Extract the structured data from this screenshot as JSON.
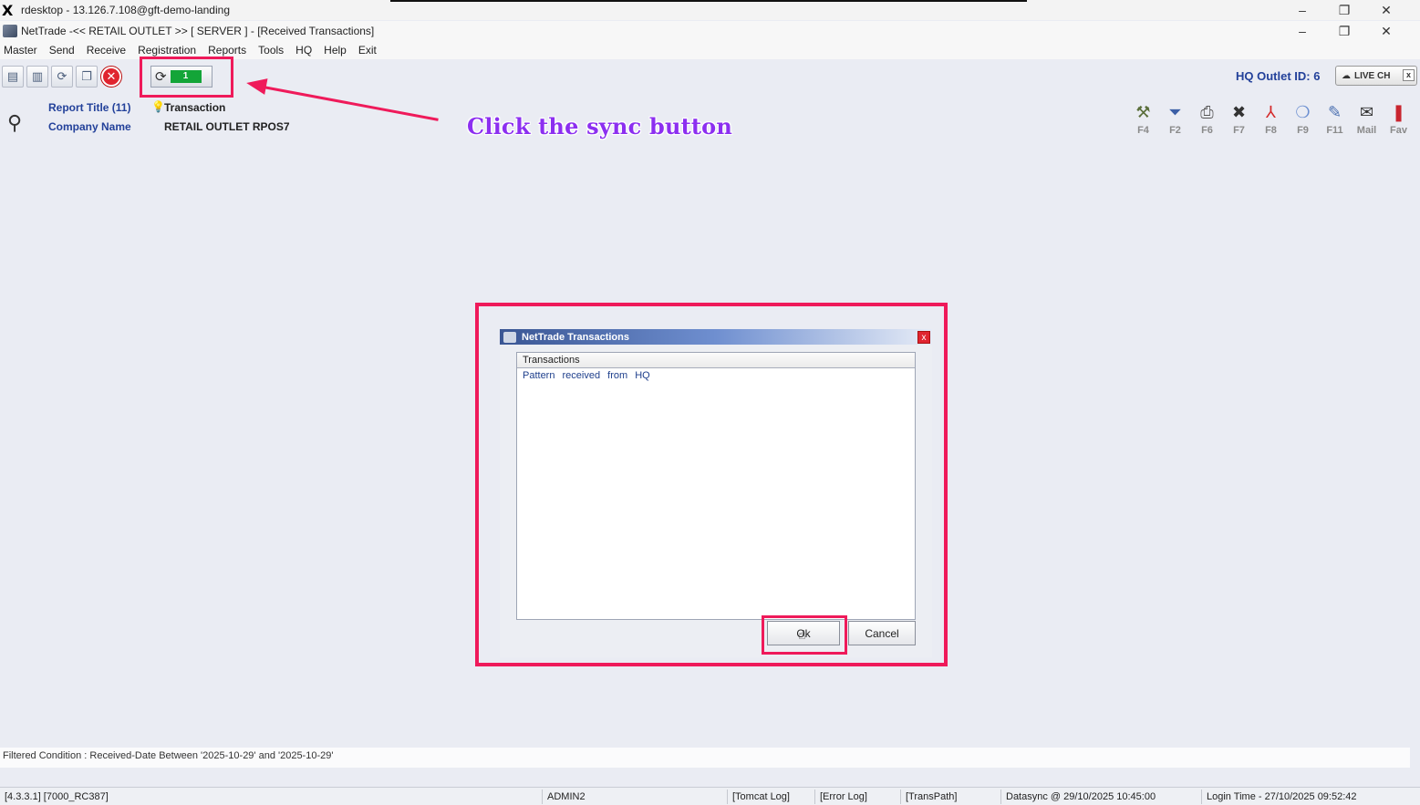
{
  "outer_window": {
    "title": "rdesktop - 13.126.7.108@gft-demo-landing",
    "x_logo": "X",
    "controls": [
      "–",
      "❐",
      "✕"
    ]
  },
  "app_window": {
    "title": "NetTrade -<< RETAIL OUTLET >> [ SERVER ] - [Received Transactions]",
    "controls": [
      "–",
      "❐",
      "✕"
    ]
  },
  "menu": [
    "Master",
    "Send",
    "Receive",
    "Registration",
    "Reports",
    "Tools",
    "HQ",
    "Help",
    "Exit"
  ],
  "toolbar": {
    "buttons": [
      {
        "icon": "new-document-icon",
        "glyph": "▤"
      },
      {
        "icon": "delete-document-icon",
        "glyph": "▥"
      },
      {
        "icon": "refresh-document-icon",
        "glyph": "⟳"
      },
      {
        "icon": "clipboard-icon",
        "glyph": "❐"
      },
      {
        "icon": "close-circle-icon",
        "glyph": "✕"
      }
    ],
    "sync": {
      "icon": "sync-icon",
      "glyph": "⟳",
      "count": "1"
    }
  },
  "annotation": {
    "text": "Click the sync button"
  },
  "hq": {
    "label": "HQ Outlet ID: 6",
    "live_button": "LIVE CH",
    "live_close": "x"
  },
  "report": {
    "title_label": "Report Title (11)",
    "title_value": "Transaction",
    "company_label": "Company Name",
    "company_value": "RETAIL OUTLET RPOS7"
  },
  "function_keys": [
    {
      "label": "F4",
      "icon": "tools-icon",
      "glyph": "⚒",
      "color": "#5a6e3a"
    },
    {
      "label": "F2",
      "icon": "filter-icon",
      "glyph": "⏷",
      "color": "#3c5fa6"
    },
    {
      "label": "F6",
      "icon": "printer-icon",
      "glyph": "⎙",
      "color": "#555555"
    },
    {
      "label": "F7",
      "icon": "excel-icon",
      "glyph": "✖",
      "color": "#333333"
    },
    {
      "label": "F8",
      "icon": "pdf-icon",
      "glyph": "⅄",
      "color": "#d42a2a"
    },
    {
      "label": "F9",
      "icon": "export-icon",
      "glyph": "❍",
      "color": "#6a8ed0"
    },
    {
      "label": "F11",
      "icon": "edit-icon",
      "glyph": "✎",
      "color": "#4a6fb0"
    },
    {
      "label": "Mail",
      "icon": "mail-icon",
      "glyph": "✉",
      "color": "#333333"
    },
    {
      "label": "Fav",
      "icon": "favourite-icon",
      "glyph": "❚",
      "color": "#c9252f"
    }
  ],
  "dialog": {
    "title": "NetTrade Transactions",
    "close": "x",
    "list_header": "Transactions",
    "items": [
      "Pattern received from HQ"
    ],
    "ok_label": "Ok",
    "cancel_label": "Cancel"
  },
  "filter": {
    "text": "Filtered Condition : Received-Date Between '2025-10-29' and '2025-10-29'"
  },
  "status": {
    "version": "[4.3.3.1] [7000_RC387]",
    "user": "ADMIN2",
    "tomcat_log": "[Tomcat Log]",
    "error_log": "[Error Log]",
    "trans_path": "[TransPath]",
    "datasync": "Datasync @ 29/10/2025 10:45:00",
    "login_time": "Login Time - 27/10/2025 09:52:42"
  },
  "colors": {
    "highlight": "#ef1a5a",
    "annotation": "#8c2ff0",
    "label_blue": "#23419a",
    "sync_green": "#13a538"
  }
}
